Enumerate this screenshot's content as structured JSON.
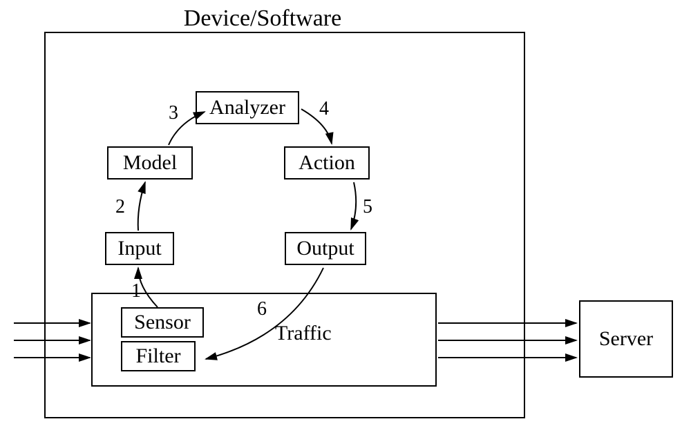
{
  "title": "Device/Software",
  "nodes": {
    "analyzer": "Analyzer",
    "model": "Model",
    "action": "Action",
    "input": "Input",
    "output": "Output",
    "sensor": "Sensor",
    "filter": "Filter",
    "traffic": "Traffic",
    "server": "Server"
  },
  "arrow_labels": {
    "n1": "1",
    "n2": "2",
    "n3": "3",
    "n4": "4",
    "n5": "5",
    "n6": "6"
  },
  "chart_data": {
    "type": "diagram",
    "title": "Device/Software",
    "containers": [
      {
        "name": "Device/Software",
        "contains": [
          "Analyzer",
          "Model",
          "Action",
          "Input",
          "Output",
          "Traffic"
        ]
      },
      {
        "name": "Traffic",
        "contains": [
          "Sensor",
          "Filter"
        ]
      }
    ],
    "nodes": [
      "Sensor",
      "Filter",
      "Input",
      "Model",
      "Analyzer",
      "Action",
      "Output",
      "Traffic",
      "Server"
    ],
    "external_node": "Server",
    "edges": [
      {
        "from": "Sensor",
        "to": "Input",
        "label": "1"
      },
      {
        "from": "Input",
        "to": "Model",
        "label": "2"
      },
      {
        "from": "Model",
        "to": "Analyzer",
        "label": "3"
      },
      {
        "from": "Analyzer",
        "to": "Action",
        "label": "4"
      },
      {
        "from": "Action",
        "to": "Output",
        "label": "5"
      },
      {
        "from": "Output",
        "to": "Filter",
        "label": "6"
      }
    ],
    "external_flows": [
      {
        "direction": "in",
        "to": "Traffic",
        "count": 3
      },
      {
        "direction": "out",
        "from": "Traffic",
        "to": "Server",
        "count": 3
      }
    ]
  }
}
